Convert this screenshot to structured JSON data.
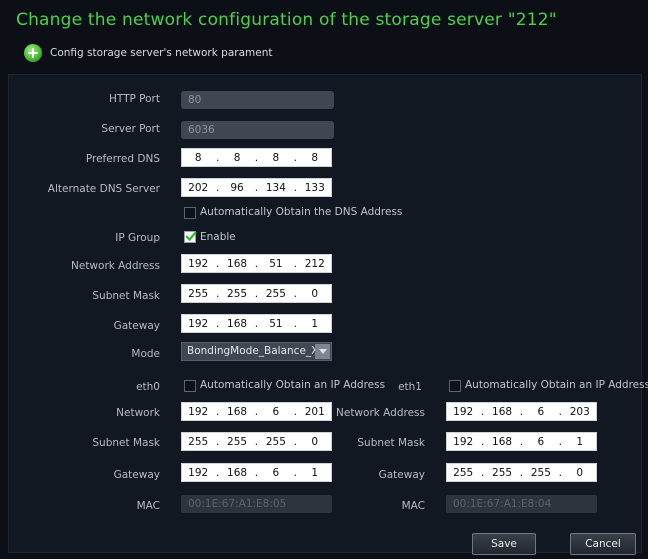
{
  "title": "Change the network configuration of the storage server \"212\"",
  "subheader": "Config storage server's network parament",
  "form": {
    "http_port": {
      "label": "HTTP Port",
      "value": "80"
    },
    "server_port": {
      "label": "Server Port",
      "value": "6036"
    },
    "preferred_dns": {
      "label": "Preferred DNS",
      "octets": [
        "8",
        "8",
        "8",
        "8"
      ]
    },
    "alternate_dns": {
      "label": "Alternate DNS Server",
      "octets": [
        "202",
        "96",
        "134",
        "133"
      ]
    },
    "auto_dns": {
      "label": "Automatically Obtain the DNS Address",
      "checked": false
    },
    "ip_group": {
      "label": "IP Group",
      "enable_label": "Enable",
      "checked": true
    },
    "network_address": {
      "label": "Network Address",
      "octets": [
        "192",
        "168",
        "51",
        "212"
      ]
    },
    "subnet_mask": {
      "label": "Subnet Mask",
      "octets": [
        "255",
        "255",
        "255",
        "0"
      ]
    },
    "gateway": {
      "label": "Gateway",
      "octets": [
        "192",
        "168",
        "51",
        "1"
      ]
    },
    "mode": {
      "label": "Mode",
      "value": "BondingMode_Balance_X"
    }
  },
  "eth0": {
    "label": "eth0",
    "auto_ip_label": "Automatically Obtain an IP Address",
    "auto_ip_checked": false,
    "network": {
      "label": "Network",
      "octets": [
        "192",
        "168",
        "6",
        "201"
      ]
    },
    "subnet_mask": {
      "label": "Subnet Mask",
      "octets": [
        "255",
        "255",
        "255",
        "0"
      ]
    },
    "gateway": {
      "label": "Gateway",
      "octets": [
        "192",
        "168",
        "6",
        "1"
      ]
    },
    "mac": {
      "label": "MAC",
      "value": "00:1E:67:A1:E8:05"
    }
  },
  "eth1": {
    "label": "eth1",
    "auto_ip_label": "Automatically Obtain an IP Address",
    "auto_ip_checked": false,
    "network_address": {
      "label": "Network Address",
      "octets": [
        "192",
        "168",
        "6",
        "203"
      ]
    },
    "subnet_mask": {
      "label": "Subnet Mask",
      "octets": [
        "192",
        "168",
        "6",
        "1"
      ]
    },
    "gateway": {
      "label": "Gateway",
      "octets": [
        "255",
        "255",
        "255",
        "0"
      ]
    },
    "mac": {
      "label": "MAC",
      "value": "00:1E:67:A1:E8:04"
    }
  },
  "buttons": {
    "save": "Save",
    "cancel": "Cancel"
  },
  "colors": {
    "title": "#4bd14b",
    "background": "#0c0f15",
    "panel": "#121821"
  }
}
